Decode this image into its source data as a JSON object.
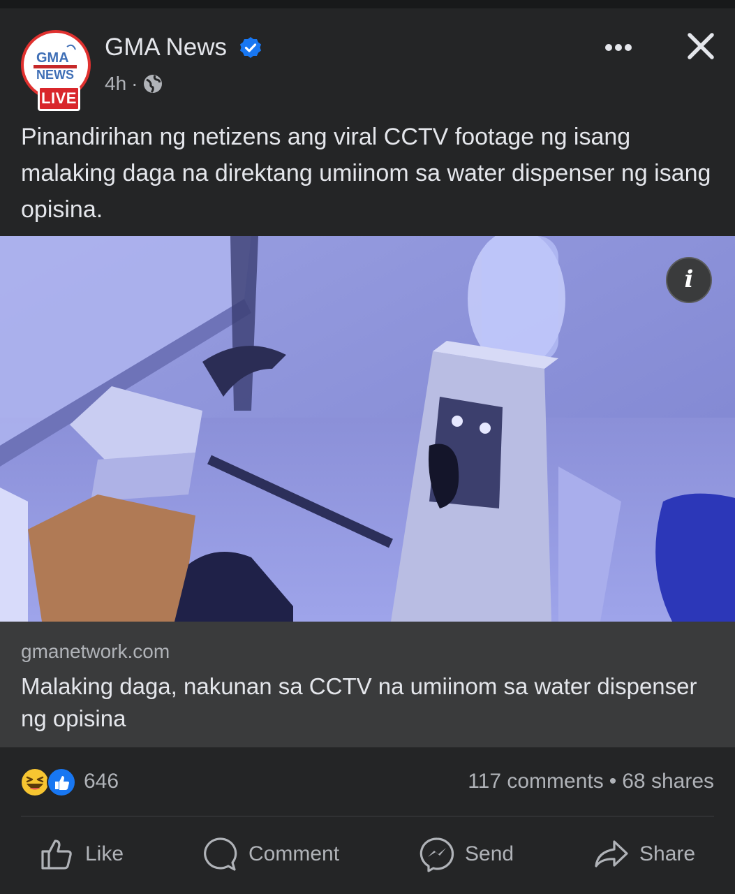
{
  "post": {
    "page_name": "GMA News",
    "time": "4h",
    "meta_separator": "·",
    "live_badge": "LIVE",
    "logo_text": "GMA NEWS",
    "caption": "Pinandirihan ng netizens ang viral CCTV footage ng isang malaking daga na direktang umiinom sa water dispenser ng isang opisina."
  },
  "link_preview": {
    "domain": "gmanetwork.com",
    "title": "Malaking daga, nakunan sa CCTV na umiinom sa water dispenser ng opisina",
    "info_icon_label": "i"
  },
  "stats": {
    "reactions_count": "646",
    "reactions": [
      "haha-icon",
      "like-icon"
    ],
    "comments": "117 comments",
    "separator": "•",
    "shares": "68 shares"
  },
  "actions": {
    "like": "Like",
    "comment": "Comment",
    "send": "Send",
    "share": "Share"
  },
  "colors": {
    "background": "#242526",
    "link_box": "#3a3b3c",
    "verified_blue": "#1877f2",
    "live_red": "#d9262b",
    "text_primary": "#e4e6eb",
    "text_secondary": "#b0b3b8"
  }
}
